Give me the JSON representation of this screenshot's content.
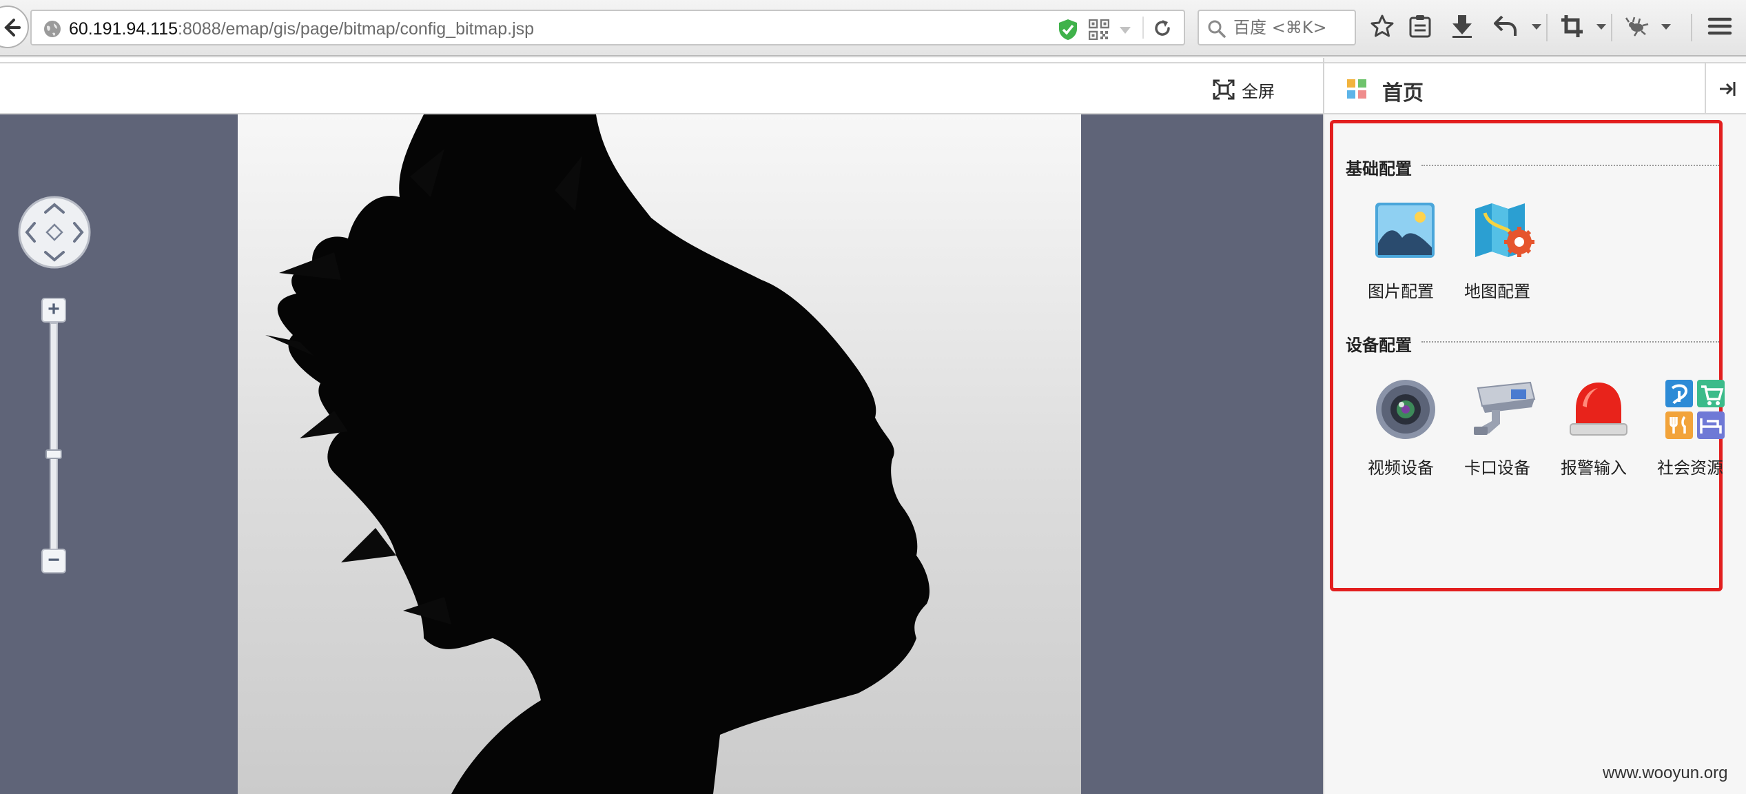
{
  "browser": {
    "url_host": "60.191.94.115",
    "url_rest": ":8088/emap/gis/page/bitmap/config_bitmap.jsp",
    "search_placeholder": "百度 <⌘K>"
  },
  "map": {
    "fullscreen_label": "全屏",
    "zoom_in_label": "+",
    "zoom_out_label": "−",
    "zoom_level": 0.42
  },
  "panel": {
    "title": "首页",
    "sections": [
      {
        "title": "基础配置",
        "items": [
          {
            "label": "图片配置",
            "icon": "image-config-icon"
          },
          {
            "label": "地图配置",
            "icon": "map-config-icon"
          }
        ]
      },
      {
        "title": "设备配置",
        "items": [
          {
            "label": "视频设备",
            "icon": "video-device-icon"
          },
          {
            "label": "卡口设备",
            "icon": "checkpoint-camera-icon"
          },
          {
            "label": "报警输入",
            "icon": "alarm-light-icon"
          },
          {
            "label": "社会资源",
            "icon": "social-resource-icon"
          }
        ]
      }
    ]
  },
  "colors": {
    "map_background": "#5f6478",
    "highlight_border": "#e21f1f"
  },
  "watermark": "www.wooyun.org"
}
